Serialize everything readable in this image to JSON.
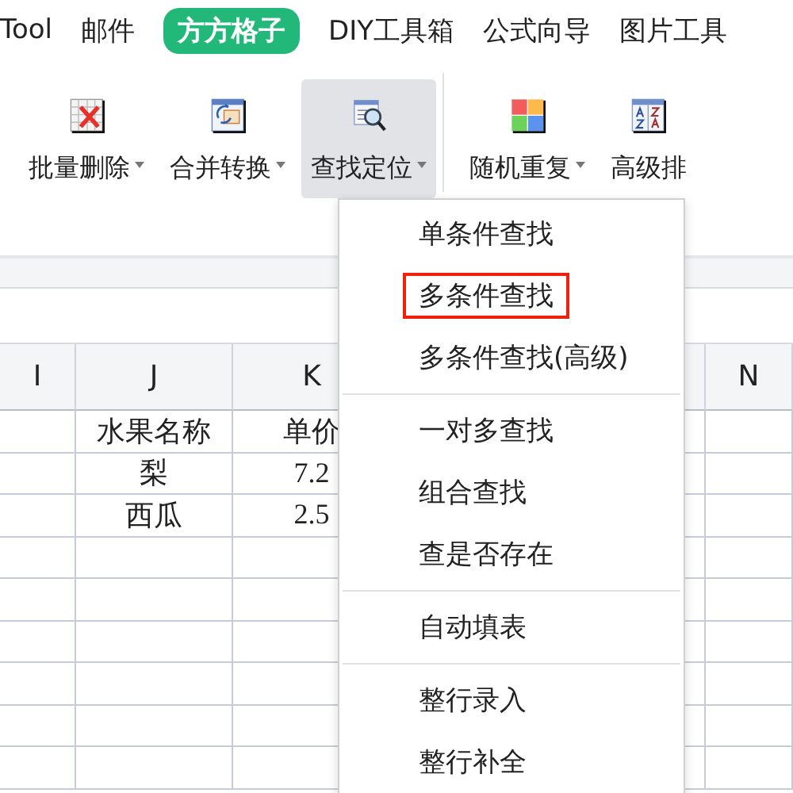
{
  "ribbon_tabs": [
    {
      "label": "Tool",
      "selected": false
    },
    {
      "label": "邮件",
      "selected": false
    },
    {
      "label": "方方格子",
      "selected": true
    },
    {
      "label": "DIY工具箱",
      "selected": false
    },
    {
      "label": "公式向导",
      "selected": false
    },
    {
      "label": "图片工具",
      "selected": false
    }
  ],
  "toolbar": [
    {
      "label": "批量删除",
      "kind": "delete",
      "selected": false,
      "dropdown": true
    },
    {
      "label": "合并转换",
      "kind": "merge",
      "selected": false,
      "dropdown": true
    },
    {
      "label": "查找定位",
      "kind": "find",
      "selected": true,
      "dropdown": true
    },
    {
      "label": "随机重复",
      "kind": "colors",
      "selected": false,
      "dropdown": true
    },
    {
      "label": "高级排",
      "kind": "sort",
      "selected": false,
      "dropdown": false
    }
  ],
  "sheet": {
    "columns": [
      "I",
      "J",
      "K",
      "",
      "N"
    ],
    "rows": [
      [
        "",
        "水果名称",
        "单价",
        "",
        ""
      ],
      [
        "",
        "梨",
        "7.2",
        "",
        ""
      ],
      [
        "",
        "西瓜",
        "2.5",
        "",
        ""
      ],
      [
        "",
        "",
        "",
        "",
        ""
      ],
      [
        "",
        "",
        "",
        "",
        ""
      ],
      [
        "",
        "",
        "",
        "",
        ""
      ],
      [
        "",
        "",
        "",
        "",
        ""
      ],
      [
        "",
        "",
        "",
        "",
        ""
      ],
      [
        "",
        "",
        "",
        "",
        ""
      ]
    ]
  },
  "dropdown_menu": {
    "groups": [
      [
        {
          "label": "单条件查找",
          "highlighted": false
        },
        {
          "label": "多条件查找",
          "highlighted": true
        },
        {
          "label": "多条件查找(高级)",
          "highlighted": false
        }
      ],
      [
        {
          "label": "一对多查找",
          "highlighted": false
        },
        {
          "label": "组合查找",
          "highlighted": false
        },
        {
          "label": "查是否存在",
          "highlighted": false
        }
      ],
      [
        {
          "label": "自动填表",
          "highlighted": false
        }
      ],
      [
        {
          "label": "整行录入",
          "highlighted": false
        },
        {
          "label": "整行补全",
          "highlighted": false
        }
      ]
    ]
  }
}
